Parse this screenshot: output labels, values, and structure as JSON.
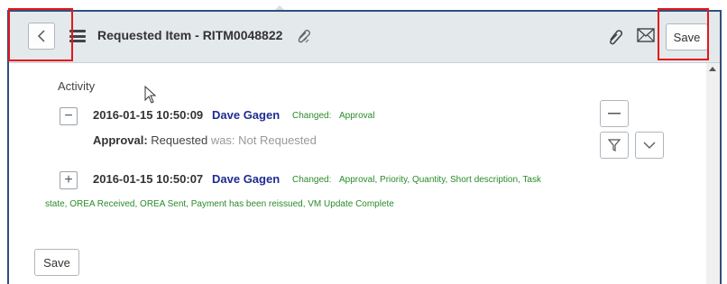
{
  "header": {
    "title": "Requested Item - RITM0048822",
    "save_label": "Save",
    "icons": [
      "chevron-left-icon",
      "hamburger-menu-icon",
      "paperclip-icon",
      "paperclip-icon",
      "envelope-icon"
    ]
  },
  "activity": {
    "label": "Activity",
    "entries": [
      {
        "timestamp": "2016-01-15 10:50:09",
        "user": "Dave Gagen",
        "changed_label": "Changed:",
        "changed_fields": "Approval",
        "toggle": "−",
        "detail_key": "Approval:",
        "detail_value": "Requested",
        "detail_was": "was: Not Requested"
      },
      {
        "timestamp": "2016-01-15 10:50:07",
        "user": "Dave Gagen",
        "changed_label": "Changed:",
        "changed_fields": "Approval, Priority, Quantity, Short description, Task",
        "changed_fields_cont": "state, OREA Received, OREA Sent, Payment has been reissued, VM Update Complete",
        "toggle": "+"
      }
    ]
  },
  "footer": {
    "save_label": "Save"
  },
  "colors": {
    "accent_red": "#e3171c",
    "user_blue": "#1f2d8f",
    "changed_green": "#2a8a2a",
    "header_bg": "#e4e9ec"
  }
}
